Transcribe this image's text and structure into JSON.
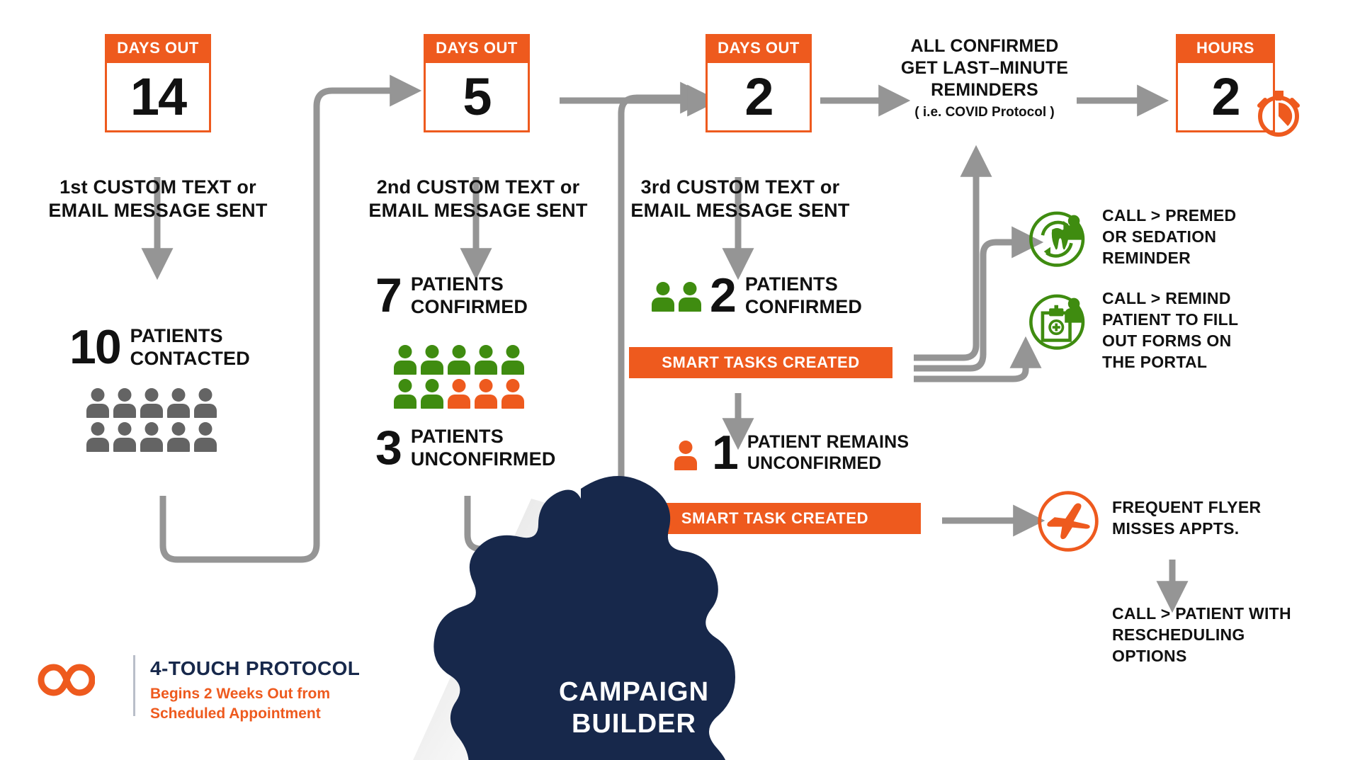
{
  "theme": {
    "orange": "#ee5a1e",
    "green": "#3f8c10",
    "gray": "#959595",
    "gray_person": "#646464",
    "navy": "#17284b",
    "black": "#111111",
    "white": "#ffffff"
  },
  "steps": [
    {
      "card": {
        "label": "DAYS OUT",
        "value": "14",
        "icon": "calendar-icon"
      },
      "heading": "1st CUSTOM TEXT or\nEMAIL MESSAGE SENT",
      "stats": [
        {
          "number": "10",
          "label": "PATIENTS\nCONTACTED",
          "icon_count": 10,
          "icon_color": "#646464"
        }
      ]
    },
    {
      "card": {
        "label": "DAYS OUT",
        "value": "5",
        "icon": "calendar-icon"
      },
      "heading": "2nd CUSTOM TEXT or\nEMAIL MESSAGE SENT",
      "stats": [
        {
          "number": "7",
          "label": "PATIENTS\nCONFIRMED",
          "icon_count": 7,
          "icon_color": "#3f8c10"
        },
        {
          "number": "3",
          "label": "PATIENTS\nUNCONFIRMED",
          "icon_count": 3,
          "icon_color": "#ee5a1e"
        }
      ]
    },
    {
      "card": {
        "label": "DAYS OUT",
        "value": "2",
        "icon": "calendar-icon"
      },
      "heading": "3rd CUSTOM TEXT or\nEMAIL MESSAGE SENT",
      "stats": [
        {
          "number": "2",
          "label": "PATIENTS\nCONFIRMED",
          "icon_count": 2,
          "icon_color": "#3f8c10"
        },
        {
          "number": "1",
          "label": "PATIENT REMAINS\nUNCONFIRMED",
          "icon_count": 1,
          "icon_color": "#ee5a1e"
        }
      ],
      "bars": [
        {
          "label": "SMART TASKS CREATED"
        },
        {
          "label": "SMART  TASK CREATED"
        }
      ]
    },
    {
      "card": {
        "label": "HOURS",
        "value": "2",
        "icon": "stopwatch-icon"
      }
    }
  ],
  "confirmed_block": {
    "line1": "ALL CONFIRMED",
    "line2": "GET LAST–MINUTE",
    "line3": "REMINDERS",
    "note": "( i.e. COVID Protocol )"
  },
  "outcomes": [
    {
      "icon": "tooth-recall-icon",
      "text": "CALL > PREMED\nOR SEDATION\nREMINDER"
    },
    {
      "icon": "clipboard-forms-icon",
      "text": "CALL > REMIND\nPATIENT TO FILL\nOUT FORMS ON\nTHE PORTAL"
    },
    {
      "icon": "airplane-icon",
      "text": "FREQUENT FLYER\nMISSES APPTS."
    }
  ],
  "followup": {
    "text": "CALL > PATIENT  WITH\nRESCHEDULING\nOPTIONS"
  },
  "brand": {
    "logo": "infinity-logo-icon",
    "title": "4-TOUCH PROTOCOL",
    "subtitle": "Begins 2 Weeks Out from\nScheduled Appointment"
  },
  "campaign_builder": {
    "line1": "CAMPAIGN",
    "line2": "BUILDER"
  }
}
